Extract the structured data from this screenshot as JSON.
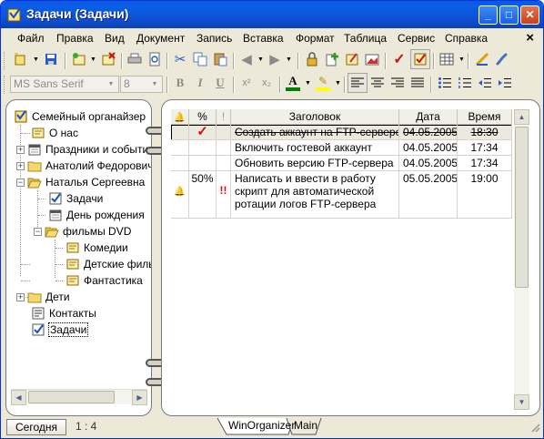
{
  "window": {
    "title": "Задачи (Задачи)",
    "minimize_label": "_",
    "maximize_label": "□",
    "close_label": "✕",
    "title_color": "#0A58E4"
  },
  "menubar": {
    "items": [
      "Файл",
      "Правка",
      "Вид",
      "Документ",
      "Запись",
      "Вставка",
      "Формат",
      "Таблица",
      "Сервис",
      "Справка"
    ],
    "close_label": "×"
  },
  "toolbar1": {
    "buttons": [
      "new-document",
      "save",
      "new-record",
      "delete-record",
      "print",
      "print-preview",
      "cut",
      "copy",
      "paste",
      "back",
      "forward",
      "lock",
      "add-entry",
      "edit-entry",
      "insert-picture",
      "mark-done",
      "show-completed",
      "table",
      "spell-check",
      "link"
    ]
  },
  "toolbar2": {
    "font_name": "MS Sans Serif",
    "font_size": "8",
    "bold_label": "B",
    "italic_label": "I",
    "underline_label": "U",
    "superscript_label": "x²",
    "subscript_label": "x₂",
    "font_color_label": "A",
    "font_color": "#008000",
    "highlight_color": "#FFFF00",
    "alignment": [
      "align-left",
      "align-center",
      "align-right",
      "justify"
    ],
    "lists": [
      "bullets",
      "numbering",
      "outdent",
      "indent"
    ]
  },
  "tree": {
    "items": [
      {
        "label": "Семейный органайзер",
        "icon": "organizer-icon",
        "level": 0,
        "expander": ""
      },
      {
        "label": "О нас",
        "icon": "note-icon",
        "level": 1,
        "expander": ""
      },
      {
        "label": "Праздники и события",
        "icon": "calendar-icon",
        "level": 1,
        "expander": "+"
      },
      {
        "label": "Анатолий Федорович",
        "icon": "folder-icon",
        "level": 1,
        "expander": "+"
      },
      {
        "label": "Наталья Сергеевна",
        "icon": "folder-open-icon",
        "level": 1,
        "expander": "−"
      },
      {
        "label": "Задачи",
        "icon": "tasks-icon",
        "level": 2,
        "expander": ""
      },
      {
        "label": "День рождения",
        "icon": "calendar-icon",
        "level": 2,
        "expander": ""
      },
      {
        "label": "фильмы DVD",
        "icon": "folder-open-icon",
        "level": 2,
        "expander": "−"
      },
      {
        "label": "Комедии",
        "icon": "note-icon",
        "level": 3,
        "expander": ""
      },
      {
        "label": "Детские фильмы",
        "icon": "note-icon",
        "level": 3,
        "expander": ""
      },
      {
        "label": "Фантастика",
        "icon": "note-icon",
        "level": 3,
        "expander": ""
      },
      {
        "label": "Дети",
        "icon": "folder-icon",
        "level": 1,
        "expander": "+"
      },
      {
        "label": "Контакты",
        "icon": "contacts-icon",
        "level": 1,
        "expander": ""
      },
      {
        "label": "Задачи",
        "icon": "tasks-icon",
        "level": 1,
        "expander": "",
        "selected": true
      }
    ]
  },
  "tasks_table": {
    "columns": [
      "🔔",
      "%",
      "!",
      "Заголовок",
      "Дата",
      "Время"
    ],
    "rows": [
      {
        "reminder": "",
        "percent": "",
        "done": true,
        "priority": "",
        "title": "Создать аккаунт на FTP-сервере",
        "date": "04.05.2005",
        "time": "18:30",
        "completed": true
      },
      {
        "reminder": "",
        "percent": "",
        "done": false,
        "priority": "",
        "title": "Включить гостевой аккаунт",
        "date": "04.05.2005",
        "time": "17:34",
        "completed": false
      },
      {
        "reminder": "",
        "percent": "",
        "done": false,
        "priority": "",
        "title": "Обновить версию FTP-сервера",
        "date": "04.05.2005",
        "time": "17:34",
        "completed": false
      },
      {
        "reminder": "🔔",
        "percent": "50%",
        "done": false,
        "priority": "!!",
        "title": "Написать и ввести в работу скрипт для автоматической ротации логов FTP-сервера",
        "date": "05.05.2005",
        "time": "19:00",
        "completed": false
      }
    ]
  },
  "statusbar": {
    "today_label": "Сегодня",
    "zoom": "1 : 4",
    "tabs": [
      "WinOrganizer",
      "Main"
    ]
  }
}
